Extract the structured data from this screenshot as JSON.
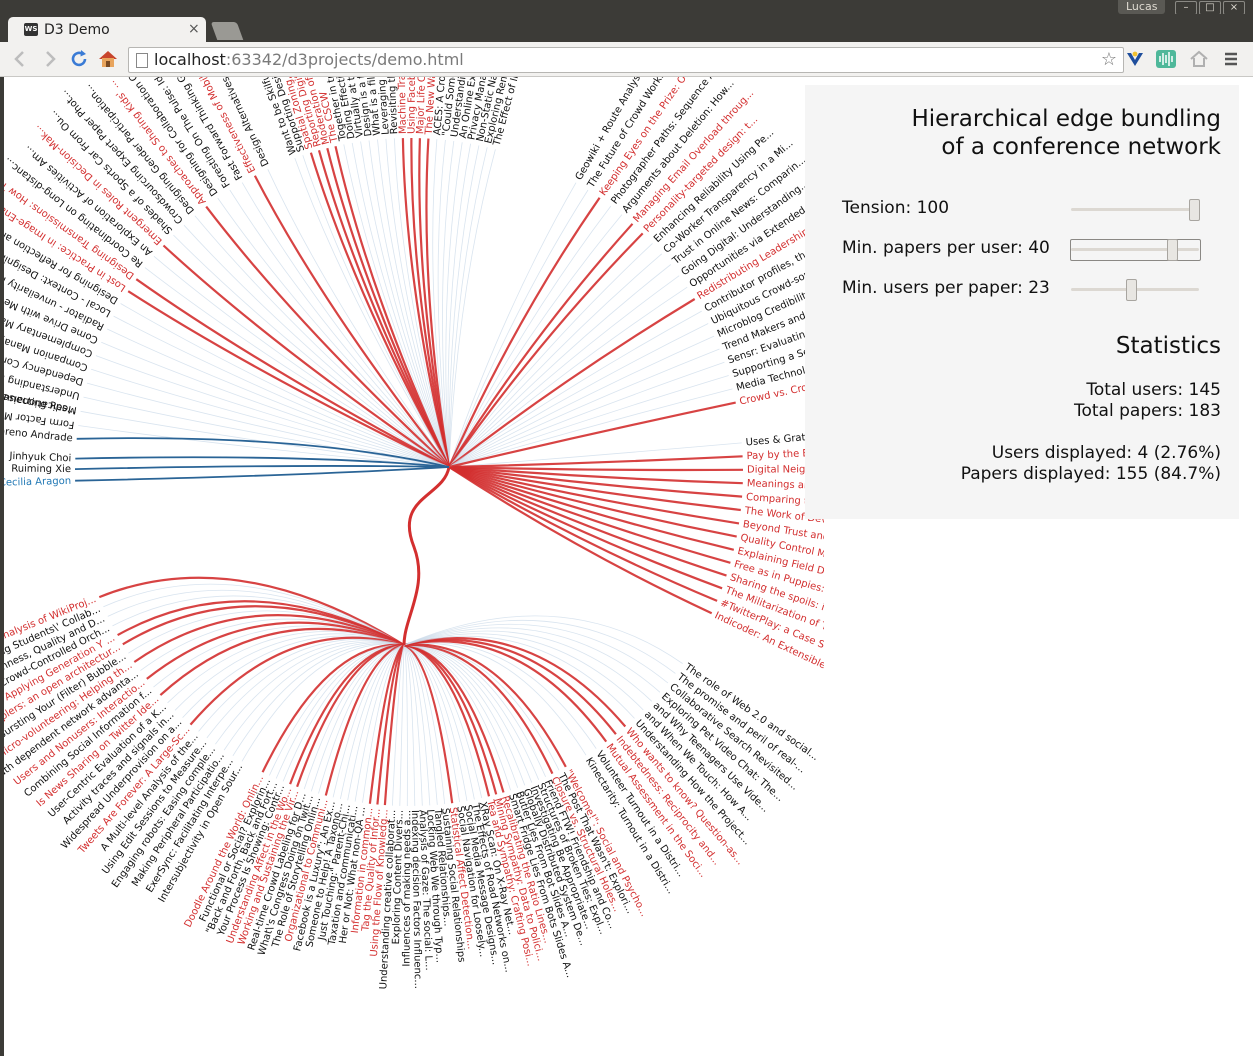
{
  "os": {
    "user": "Lucas",
    "buttons": [
      "–",
      "□",
      "×"
    ]
  },
  "browser": {
    "tab_title": "D3 Demo",
    "tab_favicon": "WS",
    "tab_close": "×",
    "url_host": "localhost",
    "url_rest": ":63342/d3projects/demo.html",
    "icons": [
      "back-arrow-icon",
      "forward-arrow-icon",
      "reload-icon",
      "home-icon",
      "page-icon",
      "star-icon",
      "extension-icon",
      "equalizer-icon",
      "home-outline-icon",
      "menu-icon"
    ]
  },
  "panel": {
    "title_line1": "Hierarchical edge bundling",
    "title_line2": "of a conference network",
    "controls": [
      {
        "label": "Tension:  100",
        "value": 100,
        "min": 0,
        "max": 100
      },
      {
        "label": "Min. papers per user:  40",
        "value": 40,
        "fraction": 0.79
      },
      {
        "label": "Min. users per paper:  23",
        "value": 23,
        "fraction": 0.46
      }
    ],
    "stats_title": "Statistics",
    "total_users": "Total users: 145",
    "total_papers": "Total papers: 183",
    "users_displayed": "Users displayed: 4 (2.76%)",
    "papers_displayed": "Papers displayed: 155 (84.7%)"
  },
  "colors": {
    "highlight": "#d32f2f",
    "user": "#1f77b4",
    "faint": "#c9d9e8",
    "text": "#111111"
  },
  "users": [
    {
      "name": "Cecilia Aragon",
      "color": "#1f77b4"
    },
    {
      "name": "Ruiming Xie",
      "color": "#111111"
    },
    {
      "name": "Jinhyuk Choi",
      "color": "#111111"
    },
    {
      "name": "Nazareno Andrade",
      "color": "#111111"
    },
    {
      "name": "Broker: Connecting Res...",
      "color": "#111111"
    }
  ],
  "papers_right": [
    {
      "name": "Uses & Gratifications of a Fac...",
      "red": false
    },
    {
      "name": "Pay by the Bit: An Information...",
      "red": true
    },
    {
      "name": "Digital Neighborhood Watch...",
      "red": true
    },
    {
      "name": "Meanings and Boundaries of...",
      "red": true
    },
    {
      "name": "Comparing the use of Social...",
      "red": true
    },
    {
      "name": "The Work of Developing C...",
      "red": true
    },
    {
      "name": "Beyond Trust and Reliabil...",
      "red": true
    },
    {
      "name": "Quality Control Mechanis...",
      "red": true
    },
    {
      "name": "Explaining Field Differen...",
      "red": true
    },
    {
      "name": "Free as in Puppies: Comp...",
      "red": true
    },
    {
      "name": "Sharing the spoils: incent...",
      "red": true
    },
    {
      "name": "The Militarization of Tear...",
      "red": true
    },
    {
      "name": "#TwitterPlay: a Case Stud...",
      "red": true
    },
    {
      "name": "Indicoder: An Extensible S...",
      "red": true
    }
  ],
  "papers_top_right": [
    {
      "name": "Geowiki + Route Analysis = Imp...",
      "red": false
    },
    {
      "name": "The Future of Crowd Work...",
      "red": false
    },
    {
      "name": "Keeping Eyes on the Prize: Off...",
      "red": true
    },
    {
      "name": "Photographer Paths: Sequence A...",
      "red": false
    },
    {
      "name": "Arguments about Deletion: How...",
      "red": false
    },
    {
      "name": "Managing Email Overload throug...",
      "red": true
    },
    {
      "name": "Personality-targeted design: t...",
      "red": true
    },
    {
      "name": "Enhancing Reliability Using Pe...",
      "red": false
    },
    {
      "name": "Co-Worker Transparency in a Mi...",
      "red": false
    },
    {
      "name": "Trust in Online News: Comparin...",
      "red": false
    },
    {
      "name": "Going Digital: Understanding...",
      "red": false
    },
    {
      "name": "Opportunities via Extended Net...",
      "red": false
    },
    {
      "name": "Redistributing Leadership in O...",
      "red": true
    },
    {
      "name": "Contributor profiles, their ev...",
      "red": false
    },
    {
      "name": "Ubiquitous Crowd-sourcing into...",
      "red": false
    },
    {
      "name": "Microblog Credibility Percept...",
      "red": false
    },
    {
      "name": "Trend Makers and Trend Spotter...",
      "red": false
    },
    {
      "name": "Sensr: Evaluating A Flexible F...",
      "red": false
    },
    {
      "name": "Supporting a Sense of Connecte...",
      "red": false
    },
    {
      "name": "Media Technologies and Learnin...",
      "red": false
    },
    {
      "name": "Crowd vs. Crowd: Large-Scale C...",
      "red": true
    }
  ],
  "papers_top": [
    {
      "name": "The Effect of Interaction Moc",
      "red": false
    },
    {
      "name": "Exploring Remembrance and",
      "red": false
    },
    {
      "name": "Non-Static Nature of Patien",
      "red": false
    },
    {
      "name": "Privacy Management in Dy",
      "red": false
    },
    {
      "name": "An Online Experiment in T",
      "red": false
    },
    {
      "name": "Understanding Visual Atte",
      "red": false
    },
    {
      "name": "\"Could Someone Please Tr",
      "red": false
    },
    {
      "name": "ACES: A Cross-Discipline",
      "red": false
    },
    {
      "name": "The New War Correspon",
      "red": true
    },
    {
      "name": "Major Life Changes and E",
      "red": true
    },
    {
      "name": "Using Facebook after losi",
      "red": true
    },
    {
      "name": "Machine Translation vs. Co",
      "red": true
    },
    {
      "name": "Revisiting the Relationship",
      "red": false
    },
    {
      "name": "Leveraging Partner's Insight",
      "red": false
    },
    {
      "name": "What is a file?",
      "red": false
    },
    {
      "name": "Design is a file?",
      "red": false
    },
    {
      "name": "Virtually at the t",
      "red": false
    },
    {
      "name": "Doing Effective Wind",
      "red": false
    },
    {
      "name": "Together in tr",
      "red": false
    },
    {
      "name": "The CSCW",
      "red": true
    },
    {
      "name": "Moderation of",
      "red": true
    },
    {
      "name": "Reporting Digital",
      "red": true
    },
    {
      "name": "Spatial Zoning, Bodi",
      "red": true
    },
    {
      "name": "Supporting Design Think",
      "red": false
    },
    {
      "name": "Want to be Skilful Spoken",
      "red": false
    }
  ],
  "papers_top_left": [
    {
      "name": "Design Alternatives for Sound",
      "red": false
    },
    {
      "name": "Effectiveness of Mobile Multitasking",
      "red": true
    },
    {
      "name": "Fast Forward Thinking Gather",
      "red": false
    },
    {
      "name": "Foresting On The Pulse: Identi...",
      "red": false
    },
    {
      "name": "Designing for Collaboration Compo...",
      "red": false
    },
    {
      "name": "Approaches to Sharing Kids' ...",
      "red": true
    },
    {
      "name": "Designing Gender Participation...",
      "red": false
    },
    {
      "name": "Crowdsourcing Expert Paper Phot...",
      "red": false
    },
    {
      "name": "Shades of a Sports Car From Ou...",
      "red": false
    },
    {
      "name": "Emergent Roles in Decision-Mak...",
      "red": true
    },
    {
      "name": "An Exploration of Activities Am...",
      "red": false
    },
    {
      "name": "Re Coordinating on Long-distanc...",
      "red": false
    },
    {
      "name": "Designing Transmissions: How Tra...",
      "red": true
    },
    {
      "name": "Lost in Practice: in Image-Ena...",
      "red": true
    },
    {
      "name": "Designing for Reflection and C...",
      "red": false
    },
    {
      "name": "Local - Context: Designing ...",
      "red": false
    },
    {
      "name": "Radiator - unveilarity Propagation...",
      "red": false
    },
    {
      "name": "Come Drive with Me - An Ethnog",
      "red": false
    },
    {
      "name": "Complementary Managing Dev",
      "red": false
    },
    {
      "name": "Companion Management in th",
      "red": false
    },
    {
      "name": "Dependency Conflict Detectio",
      "red": false
    },
    {
      "name": "Understanding Informal Com",
      "red": false
    },
    {
      "name": "Medicationaise: Network",
      "red": false
    },
    {
      "name": "Form Factor Matters:",
      "red": false
    }
  ],
  "papers_left": [
    {
      "name": "Content Analysis of WikiProj...",
      "red": true
    },
    {
      "name": "Facilitating Students\\' Collab...",
      "red": false
    },
    {
      "name": "The Openness, Quality and D...",
      "red": false
    },
    {
      "name": "Social Crowd-Controlled Orch...",
      "red": false
    },
    {
      "name": "Aone: Applying Generation Y ...",
      "red": true
    },
    {
      "name": "Couplers: an open architectur...",
      "red": true
    },
    {
      "name": "Bursting Your (Filter) Bubble...",
      "red": false
    },
    {
      "name": "Micro-volunteering: Helping th...",
      "red": true
    },
    {
      "name": "Path dependent network advanta...",
      "red": false
    },
    {
      "name": "Users and Nonusers: Interactio...",
      "red": true
    },
    {
      "name": "Combining Social Information f...",
      "red": false
    },
    {
      "name": "Is News Sharing on Twitter Ide...",
      "red": true
    },
    {
      "name": "User-Centric Evaluation of a K...",
      "red": false
    },
    {
      "name": "Activity traces and signals in...",
      "red": false
    },
    {
      "name": "Widespread Underprovision on a...",
      "red": false
    },
    {
      "name": "Tweets Are Forever: A Large-Sc...",
      "red": true
    },
    {
      "name": "A Multi-level Analysis of the...",
      "red": false
    },
    {
      "name": "Using Edit Sessions to Measure...",
      "red": false
    },
    {
      "name": "Engaging robots: Easing comple...",
      "red": false
    },
    {
      "name": "Making Peripheral Participatio...",
      "red": false
    },
    {
      "name": "ExerSync: Facilitating Interpe...",
      "red": false
    },
    {
      "name": "Intersubjectivity in Open Sour...",
      "red": false
    }
  ],
  "papers_bottom": [
    {
      "name": "Doodle Around the World: Onlin...",
      "red": true
    },
    {
      "name": "Functional or Social? Explorin...",
      "red": false
    },
    {
      "name": "\"Back and Forth, Back and Fort...",
      "red": false
    },
    {
      "name": "Your Process Is Showing: Contr...",
      "red": false
    },
    {
      "name": "Understanding Affect in the Wo...",
      "red": true
    },
    {
      "name": "Working and Sustaining the Vir...",
      "red": true
    },
    {
      "name": "Real-time Crowd Labeling for D...",
      "red": false
    },
    {
      "name": "What\\'s Congress Doing on Twit...",
      "red": false
    },
    {
      "name": "The Role of Storytelling Onlin...",
      "red": false
    },
    {
      "name": "Organizational to Communi...",
      "red": true
    },
    {
      "name": "Facebook is a Luxury\": An Ex...",
      "red": false
    },
    {
      "name": "Someone to Help! A Taxono...",
      "red": false
    },
    {
      "name": "Just Touching:\" Parent-Chi...",
      "red": false
    },
    {
      "name": "Taxation and communicati...",
      "red": false
    },
    {
      "name": "Her or Not: What non-QA ...",
      "red": false
    },
    {
      "name": "Information in common...",
      "red": true
    },
    {
      "name": "Tag the Quality of Infor...",
      "red": true
    },
    {
      "name": "Using the Flow of Knowledg...",
      "red": true
    },
    {
      "name": "Understanding creative collaborat...",
      "red": false
    },
    {
      "name": "Exploring Content Divers...",
      "red": false
    },
    {
      "name": "Influences of making needs a...",
      "red": false
    },
    {
      "name": "Indexing decision Factors Influenc...",
      "red": false
    },
    {
      "name": "Analysis of Gaze: The social: L...",
      "red": false
    },
    {
      "name": "Locking Web We through Typ...",
      "red": false
    },
    {
      "name": "Tangled Relationships...",
      "red": false
    },
    {
      "name": "Sustaining Social Relationships",
      "red": false
    },
    {
      "name": "Statistical Affect Detection...",
      "red": true
    },
    {
      "name": "Social Navigation for Loosely...",
      "red": false
    },
    {
      "name": "Social Media Message Designs...",
      "red": false
    },
    {
      "name": "The Effects of Road Networks on...",
      "red": false
    },
    {
      "name": "XRay Scan: On X-Ray Net...",
      "red": false
    },
    {
      "name": "Tea and Sympathy: Crafting Posi...",
      "red": true
    },
    {
      "name": "Mining Sympathy: Data to Polici...",
      "red": true
    },
    {
      "name": "Recalibrating the Ratio Lines...",
      "red": true
    },
    {
      "name": "Smart Fridge Lies From Bots Slides A...",
      "red": false
    },
    {
      "name": "Butler Lies From Bot Slides A...",
      "red": false
    },
    {
      "name": "Globally Distributed System De...",
      "red": false
    },
    {
      "name": "Investigating Be Appropriate...",
      "red": false
    },
    {
      "name": "Structures of Broken Ties: Expl...",
      "red": false
    },
    {
      "name": "Friend FTW! Friendship and Co...",
      "red": false
    },
    {
      "name": "Closure vs. Structural Holes...",
      "red": true
    },
    {
      "name": "The Post That Wasn't: Explori...",
      "red": false
    },
    {
      "name": "\"Welcome!\": Social and Psycho...",
      "red": true
    }
  ],
  "papers_bottom_right": [
    {
      "name": "Kinectarity: Turnout in a Distri...",
      "red": false
    },
    {
      "name": "Volunteer Turnout in a Distri...",
      "red": false
    },
    {
      "name": "Mutual Assessment in the Soci...",
      "red": true
    },
    {
      "name": "Indebtedness: Reciprocity and...",
      "red": true
    },
    {
      "name": "Who wants to know? Question-as...",
      "red": true
    },
    {
      "name": "Understanding How the Project...",
      "red": false
    },
    {
      "name": "and When We Touch: How A...",
      "red": false
    },
    {
      "name": "and Why Teenagers Use Vide...",
      "red": false
    },
    {
      "name": "Exploring Pet Video Chat: The...",
      "red": false
    },
    {
      "name": "Collaborative Search Revisited...",
      "red": false
    },
    {
      "name": "The promise and peril of real-...",
      "red": false
    },
    {
      "name": "The role of Web 2.0 and social...",
      "red": false
    }
  ]
}
